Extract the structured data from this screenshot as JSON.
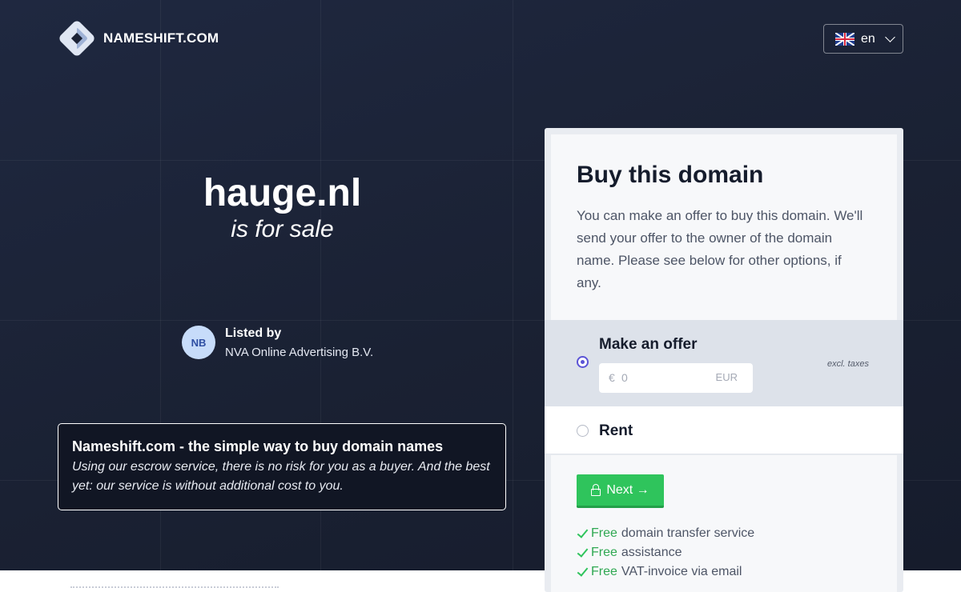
{
  "brand": {
    "name": "NAMESHIFT.COM"
  },
  "language": {
    "code": "en",
    "flag": "uk-flag"
  },
  "domain": {
    "name": "hauge.nl",
    "tagline": "is for sale"
  },
  "seller": {
    "initials": "NB",
    "label": "Listed by",
    "name": "NVA Online Advertising B.V."
  },
  "promo": {
    "title": "Nameshift.com - the simple way to buy domain names",
    "text": "Using our escrow service, there is no risk for you as a buyer. And the best yet: our service is without additional cost to you."
  },
  "buy_card": {
    "title": "Buy this domain",
    "description": "You can make an offer to buy this domain. We'll send your offer to the owner of the domain name. Please see below for other options, if any.",
    "options": [
      {
        "label": "Make an offer",
        "selected": true
      },
      {
        "label": "Rent",
        "selected": false
      }
    ],
    "excl_taxes": "excl. taxes",
    "offer_input": {
      "currency_symbol": "€",
      "placeholder": "0",
      "unit": "EUR"
    },
    "next_button": "Next →",
    "features": [
      {
        "free": "Free",
        "text": "domain transfer service"
      },
      {
        "free": "Free",
        "text": "assistance"
      },
      {
        "free": "Free",
        "text": "VAT-invoice via email"
      }
    ]
  },
  "colors": {
    "background": "#1b2235",
    "accent": "#5b54d6",
    "button": "#2fc45c"
  }
}
